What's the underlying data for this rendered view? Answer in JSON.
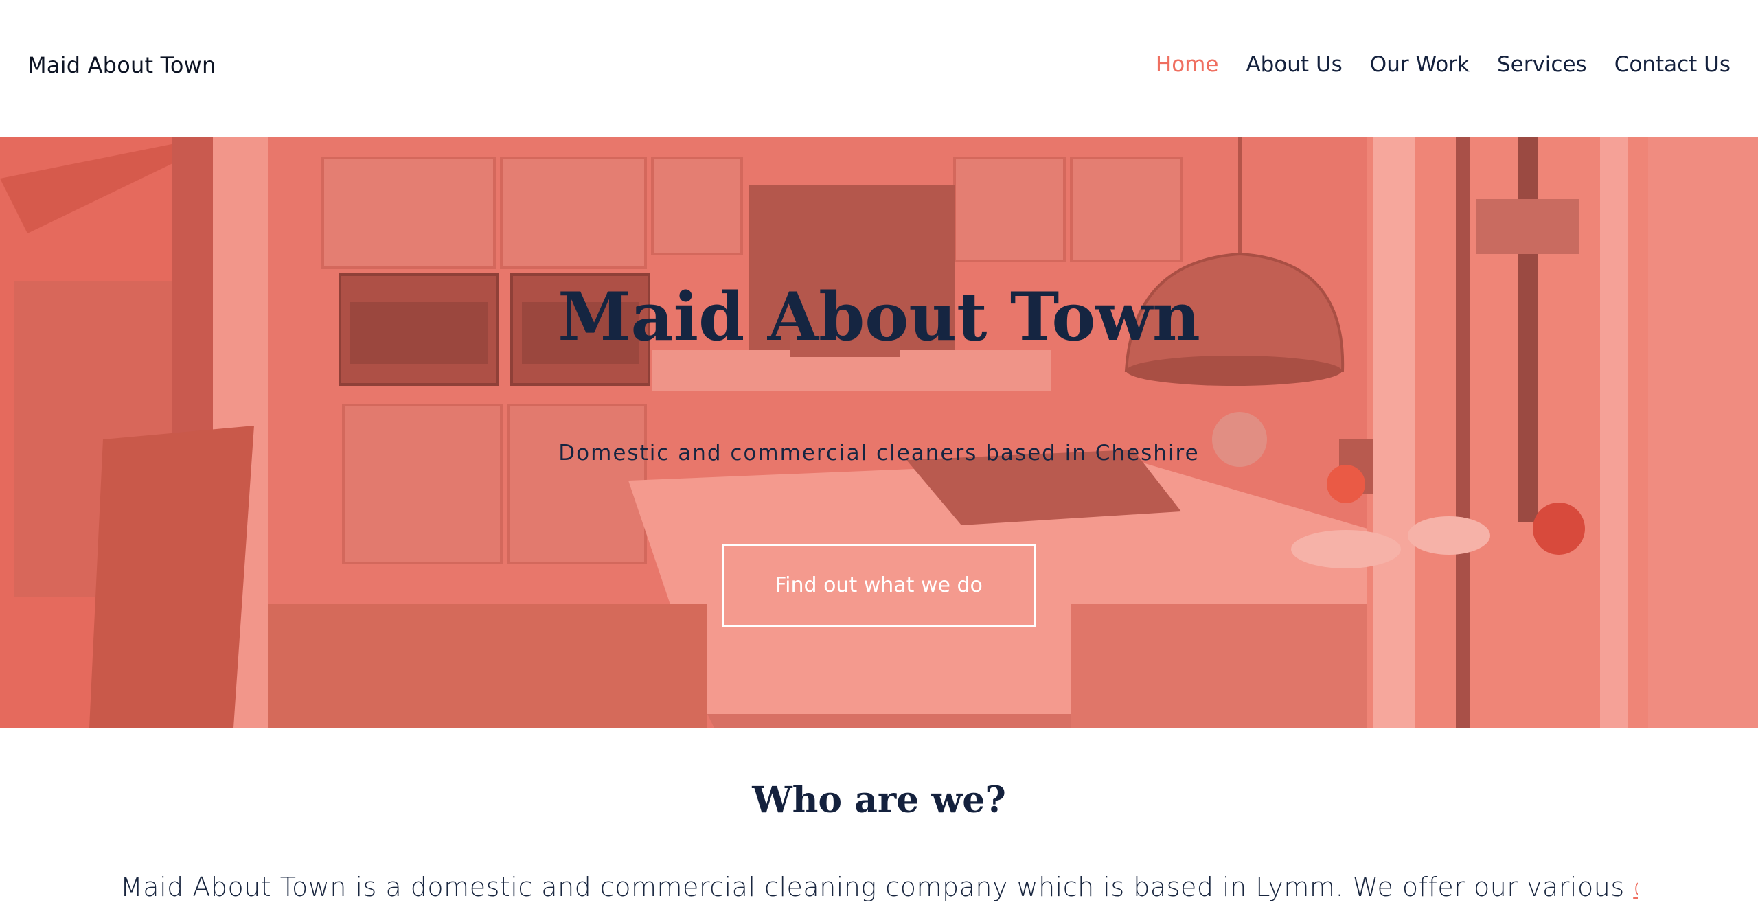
{
  "header": {
    "site_name": "Maid About Town",
    "nav": [
      {
        "label": "Home",
        "active": true
      },
      {
        "label": "About Us",
        "active": false
      },
      {
        "label": "Our Work",
        "active": false
      },
      {
        "label": "Services",
        "active": false
      },
      {
        "label": "Contact Us",
        "active": false
      }
    ]
  },
  "hero": {
    "title": "Maid About Town",
    "subtitle": "Domestic and commercial cleaners based in Cheshire",
    "button_label": "Find out what we do",
    "background": "kitchen photo with coral overlay"
  },
  "about": {
    "heading": "Who are we?",
    "intro_text": "Maid About Town is a domestic and commercial cleaning company which is based in Lymm. We offer our various ",
    "intro_link": "different"
  },
  "colors": {
    "accent": "#ef6f60",
    "navy": "#14213d",
    "overlay": "#ea7468"
  }
}
